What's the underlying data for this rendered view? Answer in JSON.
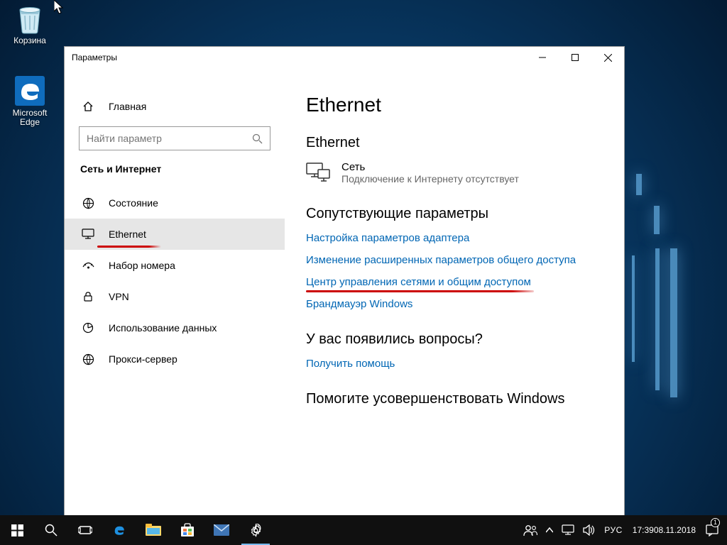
{
  "desktop": {
    "recycle_label": "Корзина",
    "edge_label": "Microsoft Edge"
  },
  "window": {
    "title": "Параметры",
    "sidebar": {
      "home": "Главная",
      "search_placeholder": "Найти параметр",
      "section": "Сеть и Интернет",
      "items": [
        {
          "label": "Состояние"
        },
        {
          "label": "Ethernet"
        },
        {
          "label": "Набор номера"
        },
        {
          "label": "VPN"
        },
        {
          "label": "Использование данных"
        },
        {
          "label": "Прокси-сервер"
        }
      ]
    },
    "content": {
      "h1": "Ethernet",
      "h2": "Ethernet",
      "net_name": "Сеть",
      "net_status": "Подключение к Интернету отсутствует",
      "related_heading": "Сопутствующие параметры",
      "links": [
        "Настройка параметров адаптера",
        "Изменение расширенных параметров общего доступа",
        "Центр управления сетями и общим доступом",
        "Брандмауэр Windows"
      ],
      "questions_heading": "У вас появились вопросы?",
      "help_link": "Получить помощь",
      "improve_heading": "Помогите усовершенствовать Windows"
    }
  },
  "taskbar": {
    "lang": "РУС",
    "time": "17:39",
    "date": "08.11.2018",
    "notif_count": "1"
  }
}
